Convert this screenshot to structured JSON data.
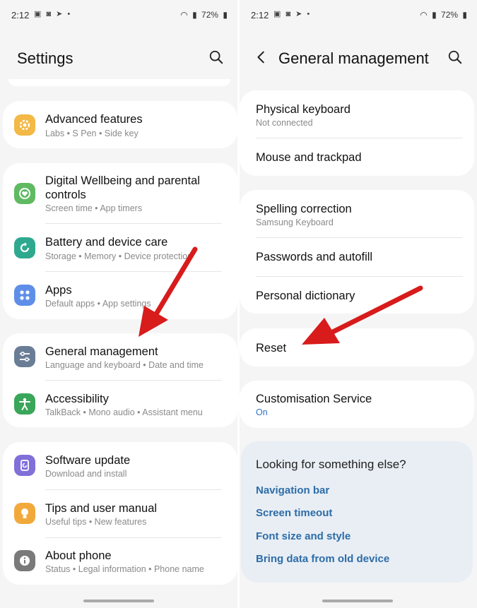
{
  "status_bar": {
    "time": "2:12",
    "notifications": "▣ ◙ ➤ •",
    "battery": "72%"
  },
  "left": {
    "title": "Settings",
    "groups": [
      {
        "items": [
          {
            "title": "Advanced features",
            "subtitle": "Labs  •  S Pen  •  Side key",
            "icon": "star-gear-icon",
            "color": "#f3b845"
          }
        ]
      },
      {
        "items": [
          {
            "title": "Digital Wellbeing and parental controls",
            "subtitle": "Screen time  •  App timers",
            "icon": "heart-circle-icon",
            "color": "#5fba62"
          },
          {
            "title": "Battery and device care",
            "subtitle": "Storage  •  Memory  •  Device protection",
            "icon": "refresh-care-icon",
            "color": "#2ea98f"
          },
          {
            "title": "Apps",
            "subtitle": "Default apps  •  App settings",
            "icon": "apps-grid-icon",
            "color": "#5f8ee8"
          }
        ]
      },
      {
        "items": [
          {
            "title": "General management",
            "subtitle": "Language and keyboard  •  Date and time",
            "icon": "sliders-icon",
            "color": "#6a7d96"
          },
          {
            "title": "Accessibility",
            "subtitle": "TalkBack  •  Mono audio  •  Assistant menu",
            "icon": "person-icon",
            "color": "#3aa65a"
          }
        ]
      },
      {
        "items": [
          {
            "title": "Software update",
            "subtitle": "Download and install",
            "icon": "update-icon",
            "color": "#8070d8"
          },
          {
            "title": "Tips and user manual",
            "subtitle": "Useful tips  •  New features",
            "icon": "bulb-icon",
            "color": "#f2a93b"
          },
          {
            "title": "About phone",
            "subtitle": "Status  •  Legal information  •  Phone name",
            "icon": "info-icon",
            "color": "#7a7a7a"
          }
        ]
      }
    ]
  },
  "right": {
    "title": "General management",
    "groups": [
      {
        "items": [
          {
            "title": "Physical keyboard",
            "subtitle": "Not connected"
          },
          {
            "title": "Mouse and trackpad",
            "subtitle": ""
          }
        ]
      },
      {
        "items": [
          {
            "title": "Spelling correction",
            "subtitle": "Samsung Keyboard"
          },
          {
            "title": "Passwords and autofill",
            "subtitle": ""
          },
          {
            "title": "Personal dictionary",
            "subtitle": ""
          }
        ]
      },
      {
        "items": [
          {
            "title": "Reset",
            "subtitle": ""
          }
        ]
      },
      {
        "items": [
          {
            "title": "Customisation Service",
            "subtitle": "On"
          }
        ]
      }
    ],
    "suggestions": {
      "title": "Looking for something else?",
      "links": [
        "Navigation bar",
        "Screen timeout",
        "Font size and style",
        "Bring data from old device"
      ]
    }
  },
  "colors": {
    "link": "#2d6ca8",
    "arrow": "#d81b1b",
    "on_status": "#2d74c4"
  }
}
